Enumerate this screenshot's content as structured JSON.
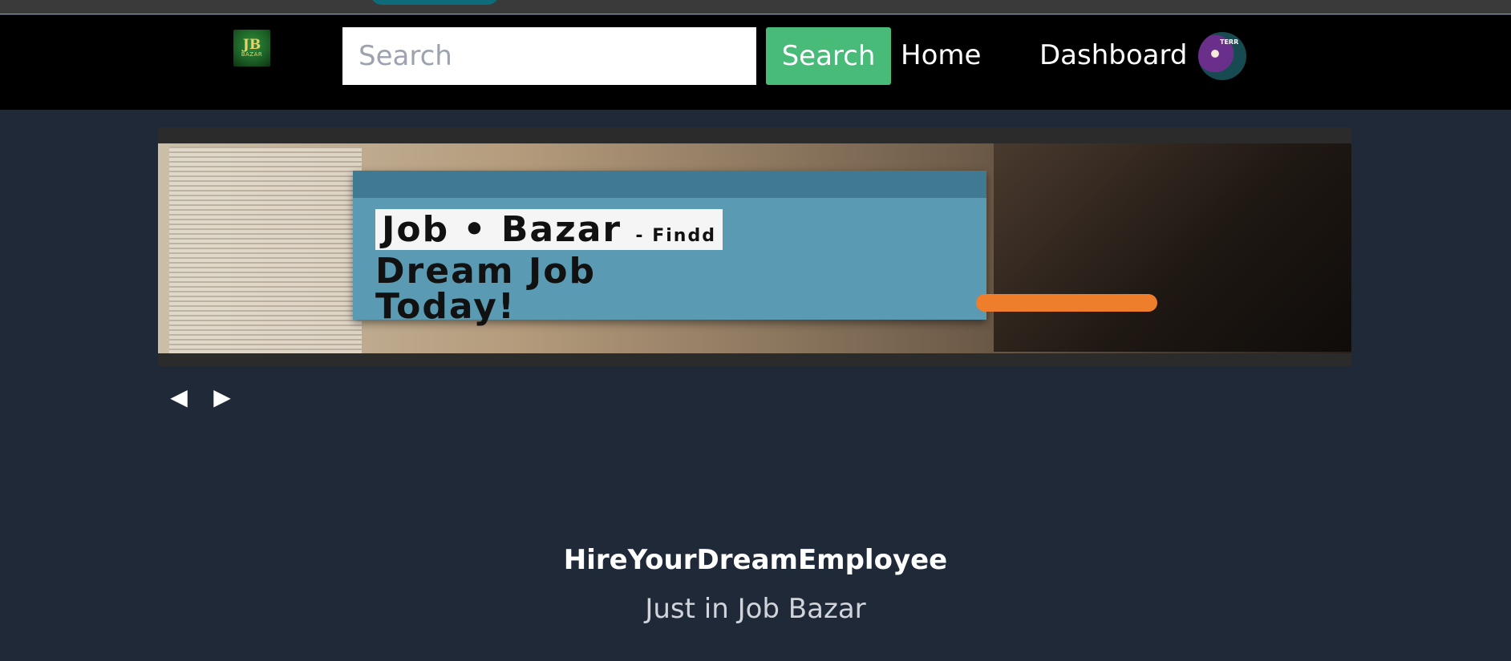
{
  "browser": {
    "active_tab_color": "#0e6b7a"
  },
  "navbar": {
    "logo": {
      "mark": "JB",
      "word": "BAZAR",
      "icon": "job-bazar-logo"
    },
    "search": {
      "placeholder": "Search",
      "value": "",
      "button_label": "Search"
    },
    "links": [
      {
        "label": "Home"
      },
      {
        "label": "Dashboard"
      }
    ],
    "avatar": {
      "alt": "user-avatar",
      "badge": "TERR"
    }
  },
  "banner": {
    "top_text": "",
    "card_header": "",
    "card_caption": "",
    "headline_line1": "Job • Bazar",
    "headline_line1_suffix": "- Findd",
    "headline_line2": "Dream Job",
    "headline_line3": "Today!",
    "body": "",
    "cta": "",
    "footer": ""
  },
  "carousel": {
    "prev": "◀",
    "next": "▶"
  },
  "hero": {
    "title": "HireYourDreamEmployee",
    "subtitle": "Just in Job Bazar"
  },
  "colors": {
    "navbar_bg": "#000000",
    "page_bg": "#1f2937",
    "search_button": "#48bb78",
    "cta_orange": "#ee7e2c"
  }
}
